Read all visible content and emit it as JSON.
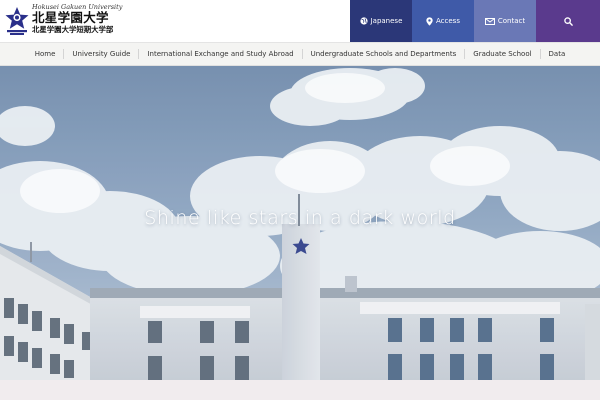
{
  "logo": {
    "name_en": "Hokusei Gakuen University",
    "name_ja": "北星学園大学",
    "name_ja_sub": "北星学園大学短期大学部"
  },
  "utility_nav": {
    "language": {
      "label": "Japanese",
      "icon": "globe-icon"
    },
    "access": {
      "label": "Access",
      "icon": "map-pin-icon"
    },
    "contact": {
      "label": "Contact",
      "icon": "mail-icon"
    },
    "search": {
      "icon": "search-icon"
    }
  },
  "global_nav": {
    "items": [
      "Home",
      "University Guide",
      "International Exchange and Study Abroad",
      "Undergraduate Schools and Departments",
      "Graduate School",
      "Data"
    ]
  },
  "hero": {
    "tagline": "Shine like stars in a dark world"
  },
  "colors": {
    "brand_navy": "#2b3778",
    "access_blue": "#3f5aa8",
    "contact_blue": "#6a78b6",
    "search_purple": "#5a3a8d",
    "logo_star": "#2a2f8a"
  }
}
